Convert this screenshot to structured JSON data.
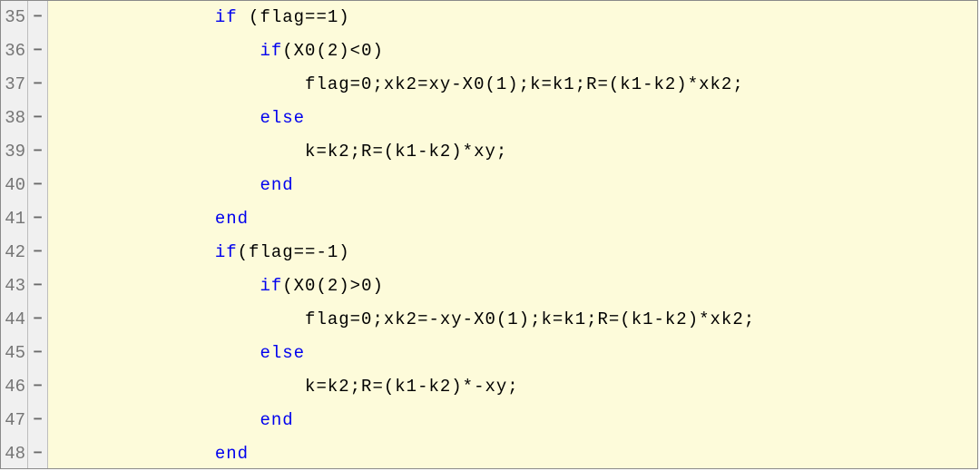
{
  "syntax": {
    "keywords": [
      "if",
      "else",
      "end"
    ],
    "highlight_color": "#0000ee"
  },
  "lines": [
    {
      "n": 35,
      "fold": "−",
      "indent": 12,
      "tokens": [
        {
          "t": "if",
          "kw": true
        },
        {
          "t": " (flag==1)"
        }
      ]
    },
    {
      "n": 36,
      "fold": "−",
      "indent": 16,
      "tokens": [
        {
          "t": "if",
          "kw": true
        },
        {
          "t": "(X0(2)<0)"
        }
      ]
    },
    {
      "n": 37,
      "fold": "−",
      "indent": 20,
      "tokens": [
        {
          "t": "flag=0;xk2=xy-X0(1);k=k1;R=(k1-k2)*xk2;"
        }
      ]
    },
    {
      "n": 38,
      "fold": "−",
      "indent": 16,
      "tokens": [
        {
          "t": "else",
          "kw": true
        }
      ]
    },
    {
      "n": 39,
      "fold": "−",
      "indent": 20,
      "tokens": [
        {
          "t": "k=k2;R=(k1-k2)*xy;"
        }
      ]
    },
    {
      "n": 40,
      "fold": "−",
      "indent": 16,
      "tokens": [
        {
          "t": "end",
          "kw": true
        }
      ]
    },
    {
      "n": 41,
      "fold": "−",
      "indent": 12,
      "tokens": [
        {
          "t": "end",
          "kw": true
        }
      ]
    },
    {
      "n": 42,
      "fold": "−",
      "indent": 12,
      "tokens": [
        {
          "t": "if",
          "kw": true
        },
        {
          "t": "(flag==-1)"
        }
      ]
    },
    {
      "n": 43,
      "fold": "−",
      "indent": 16,
      "tokens": [
        {
          "t": "if",
          "kw": true
        },
        {
          "t": "(X0(2)>0)"
        }
      ]
    },
    {
      "n": 44,
      "fold": "−",
      "indent": 20,
      "tokens": [
        {
          "t": "flag=0;xk2=-xy-X0(1);k=k1;R=(k1-k2)*xk2;"
        }
      ]
    },
    {
      "n": 45,
      "fold": "−",
      "indent": 16,
      "tokens": [
        {
          "t": "else",
          "kw": true
        }
      ]
    },
    {
      "n": 46,
      "fold": "−",
      "indent": 20,
      "tokens": [
        {
          "t": "k=k2;R=(k1-k2)*-xy;"
        }
      ]
    },
    {
      "n": 47,
      "fold": "−",
      "indent": 16,
      "tokens": [
        {
          "t": "end",
          "kw": true
        }
      ]
    },
    {
      "n": 48,
      "fold": "−",
      "indent": 12,
      "tokens": [
        {
          "t": "end",
          "kw": true
        }
      ]
    }
  ]
}
